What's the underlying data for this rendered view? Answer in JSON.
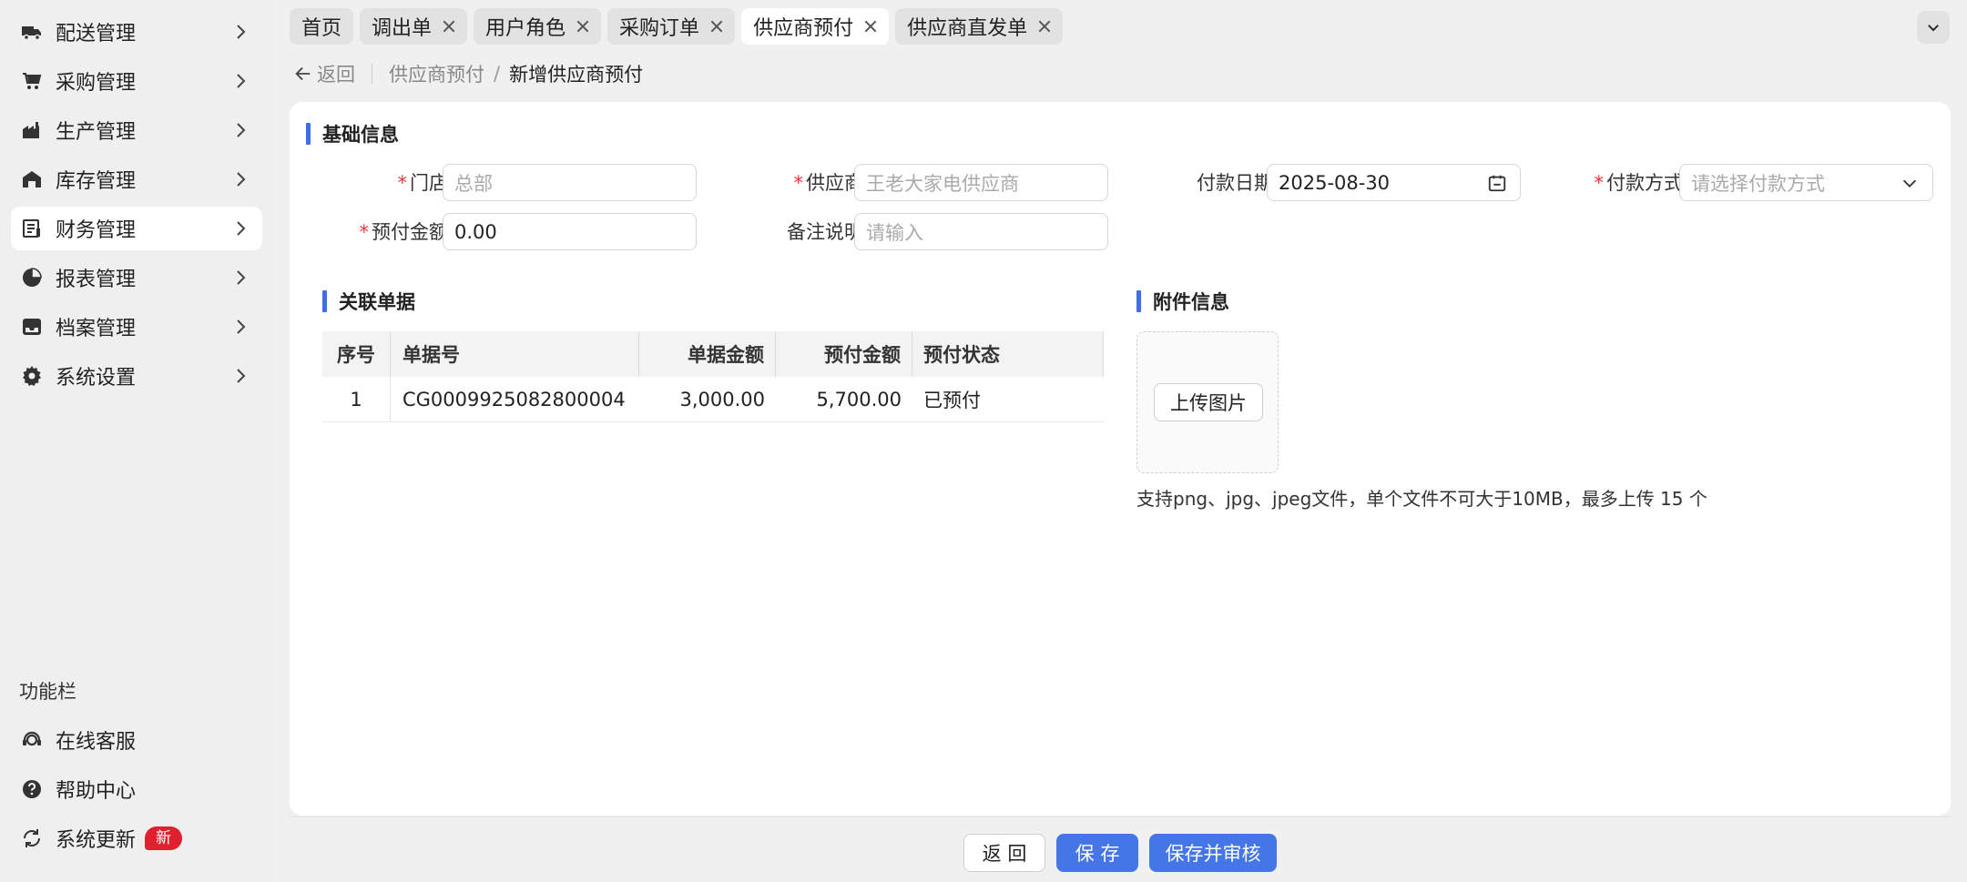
{
  "sidebar": {
    "items": [
      {
        "label": "配送管理",
        "icon": "truck-icon"
      },
      {
        "label": "采购管理",
        "icon": "cart-icon"
      },
      {
        "label": "生产管理",
        "icon": "factory-icon"
      },
      {
        "label": "库存管理",
        "icon": "warehouse-icon"
      },
      {
        "label": "财务管理",
        "icon": "finance-icon",
        "active": true
      },
      {
        "label": "报表管理",
        "icon": "pie-chart-icon"
      },
      {
        "label": "档案管理",
        "icon": "inbox-icon"
      },
      {
        "label": "系统设置",
        "icon": "gear-icon"
      }
    ],
    "section_title": "功能栏",
    "bottom_items": [
      {
        "label": "在线客服",
        "icon": "headset-icon"
      },
      {
        "label": "帮助中心",
        "icon": "help-icon"
      },
      {
        "label": "系统更新",
        "icon": "refresh-icon",
        "badge": "新"
      }
    ]
  },
  "tabs": [
    {
      "label": "首页",
      "closable": false
    },
    {
      "label": "调出单",
      "closable": true
    },
    {
      "label": "用户角色",
      "closable": true
    },
    {
      "label": "采购订单",
      "closable": true
    },
    {
      "label": "供应商预付",
      "closable": true,
      "active": true
    },
    {
      "label": "供应商直发单",
      "closable": true
    }
  ],
  "breadcrumb": {
    "back": "返回",
    "parent": "供应商预付",
    "separator": "/",
    "current": "新增供应商预付"
  },
  "basic": {
    "title": "基础信息",
    "store_label": "门店",
    "store_placeholder": "总部",
    "supplier_label": "供应商",
    "supplier_placeholder": "王老大家电供应商",
    "date_label": "付款日期",
    "date_value": "2025-08-30",
    "method_label": "付款方式",
    "method_placeholder": "请选择付款方式",
    "amount_label": "预付金额",
    "amount_value": "0.00",
    "remark_label": "备注说明",
    "remark_placeholder": "请输入",
    "required_mark": "*"
  },
  "related": {
    "title": "关联单据",
    "columns": [
      "序号",
      "单据号",
      "单据金额",
      "预付金额",
      "预付状态"
    ],
    "rows": [
      {
        "no": "1",
        "doc": "CG0009925082800004",
        "doc_amount": "3,000.00",
        "prepay": "5,700.00",
        "status": "已预付"
      }
    ]
  },
  "attachment": {
    "title": "附件信息",
    "upload_label": "上传图片",
    "hint": "支持png、jpg、jpeg文件，单个文件不可大于10MB，最多上传 15 个"
  },
  "footer": {
    "back_label": "返 回",
    "save_label": "保 存",
    "save_approve_label": "保存并审核"
  },
  "colors": {
    "accent": "#4576e8",
    "required": "#e53935",
    "badge": "#e0202e"
  }
}
